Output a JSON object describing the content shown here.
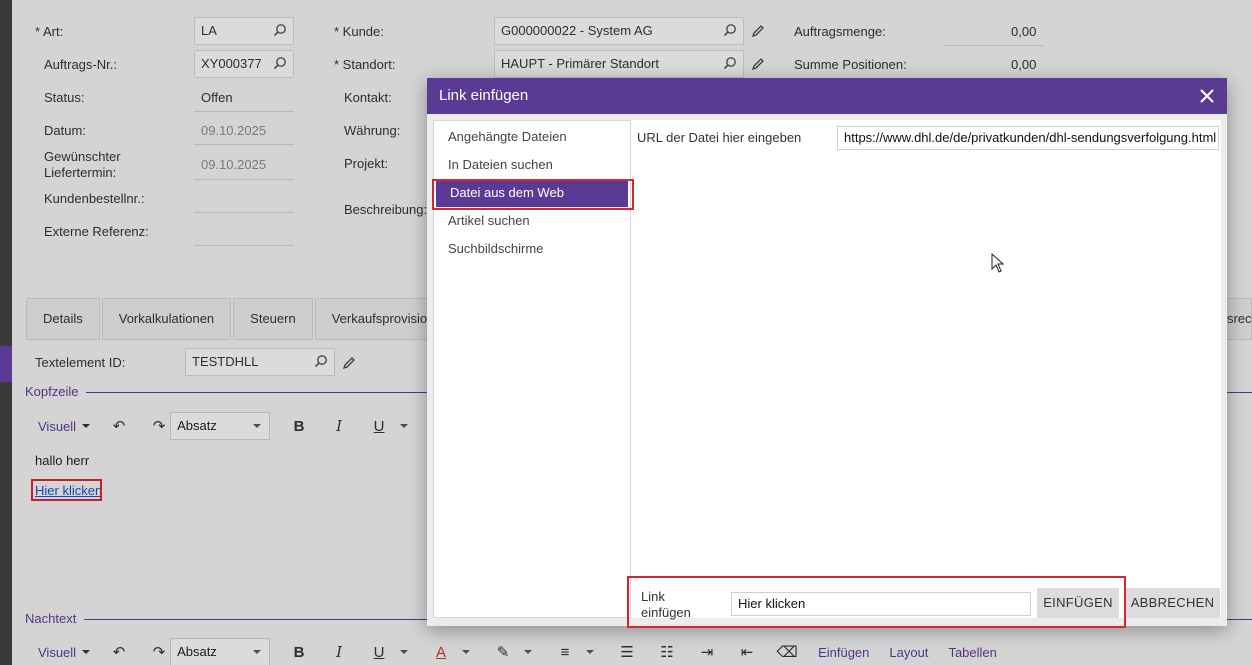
{
  "header": {
    "art": {
      "label": "* Art:",
      "value": "LA"
    },
    "auftragsnr": {
      "label": "Auftrags-Nr.:",
      "value": "XY000377"
    },
    "status": {
      "label": "Status:",
      "value": "Offen"
    },
    "datum": {
      "label": "Datum:",
      "value": "09.10.2025"
    },
    "liefertermin": {
      "label_line1": "Gewünschter",
      "label_line2": "Liefertermin:",
      "value": "09.10.2025"
    },
    "kundenbestellnr": {
      "label": "Kundenbestellnr.:",
      "value": ""
    },
    "externe_referenz": {
      "label": "Externe Referenz:",
      "value": ""
    },
    "kunde": {
      "label": "* Kunde:",
      "value": "G000000022 - System AG"
    },
    "standort": {
      "label": "* Standort:",
      "value": "HAUPT - Primärer Standort"
    },
    "kontakt": {
      "label": "Kontakt:"
    },
    "waehrung": {
      "label": "Währung:"
    },
    "projekt": {
      "label": "Projekt:"
    },
    "beschreibung": {
      "label": "Beschreibung:"
    },
    "auftragsmenge": {
      "label": "Auftragsmenge:",
      "value": "0,00"
    },
    "summe_positionen": {
      "label": "Summe Positionen:",
      "value": "0,00"
    }
  },
  "tabs": [
    "Details",
    "Vorkalkulationen",
    "Steuern",
    "Verkaufsprovision"
  ],
  "tab_clipped_right": "srec",
  "text_element": {
    "label": "Textelement ID:",
    "value": "TESTDHLL"
  },
  "sections": {
    "kopfzeile": "Kopfzeile",
    "nachtext": "Nachtext"
  },
  "editor_toolbar": {
    "mode": "Visuell",
    "format": "Absatz",
    "bold": "B",
    "italic": "I",
    "underline": "U",
    "color": "A",
    "einfuegen": "Einfügen",
    "layout": "Layout",
    "tabellen": "Tabellen"
  },
  "editor_content": {
    "line1": "hallo herr",
    "link": "Hier klicken"
  },
  "modal": {
    "title": "Link einfügen",
    "menu": [
      "Angehängte Dateien",
      "In Dateien suchen",
      "Datei aus dem Web",
      "Artikel suchen",
      "Suchbildschirme"
    ],
    "active_index": 2,
    "url_label": "URL der Datei hier eingeben",
    "url_value": "https://www.dhl.de/de/privatkunden/dhl-sendungsverfolgung.html",
    "footer_label_line1": "Link",
    "footer_label_line2": "einfügen",
    "footer_value": "Hier klicken",
    "btn_insert": "EINFÜGEN",
    "btn_cancel": "ABBRECHEN"
  },
  "colors": {
    "accent": "#5b3a96",
    "highlight": "#d4272f"
  }
}
